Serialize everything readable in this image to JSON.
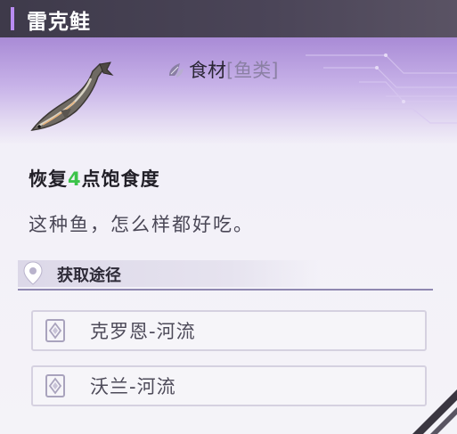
{
  "header": {
    "title": "雷克鲑"
  },
  "item": {
    "fish_icon": "fish-illustration",
    "category_icon": "leaf-flame-icon",
    "category": "食材",
    "subcategory": "[鱼类]",
    "effect_prefix": "恢复",
    "effect_value": "4",
    "effect_suffix": "点饱食度",
    "description": "这种鱼，怎么样都好吃。"
  },
  "source": {
    "icon": "location-pin-icon",
    "label": "获取途径",
    "items": [
      {
        "icon": "diamond-emblem-icon",
        "text": "克罗恩-河流"
      },
      {
        "icon": "diamond-emblem-icon",
        "text": "沃兰-河流"
      }
    ]
  },
  "colors": {
    "accent": "#b98cf2",
    "effect_value": "#3cc34a",
    "band": "#a98bd6"
  }
}
